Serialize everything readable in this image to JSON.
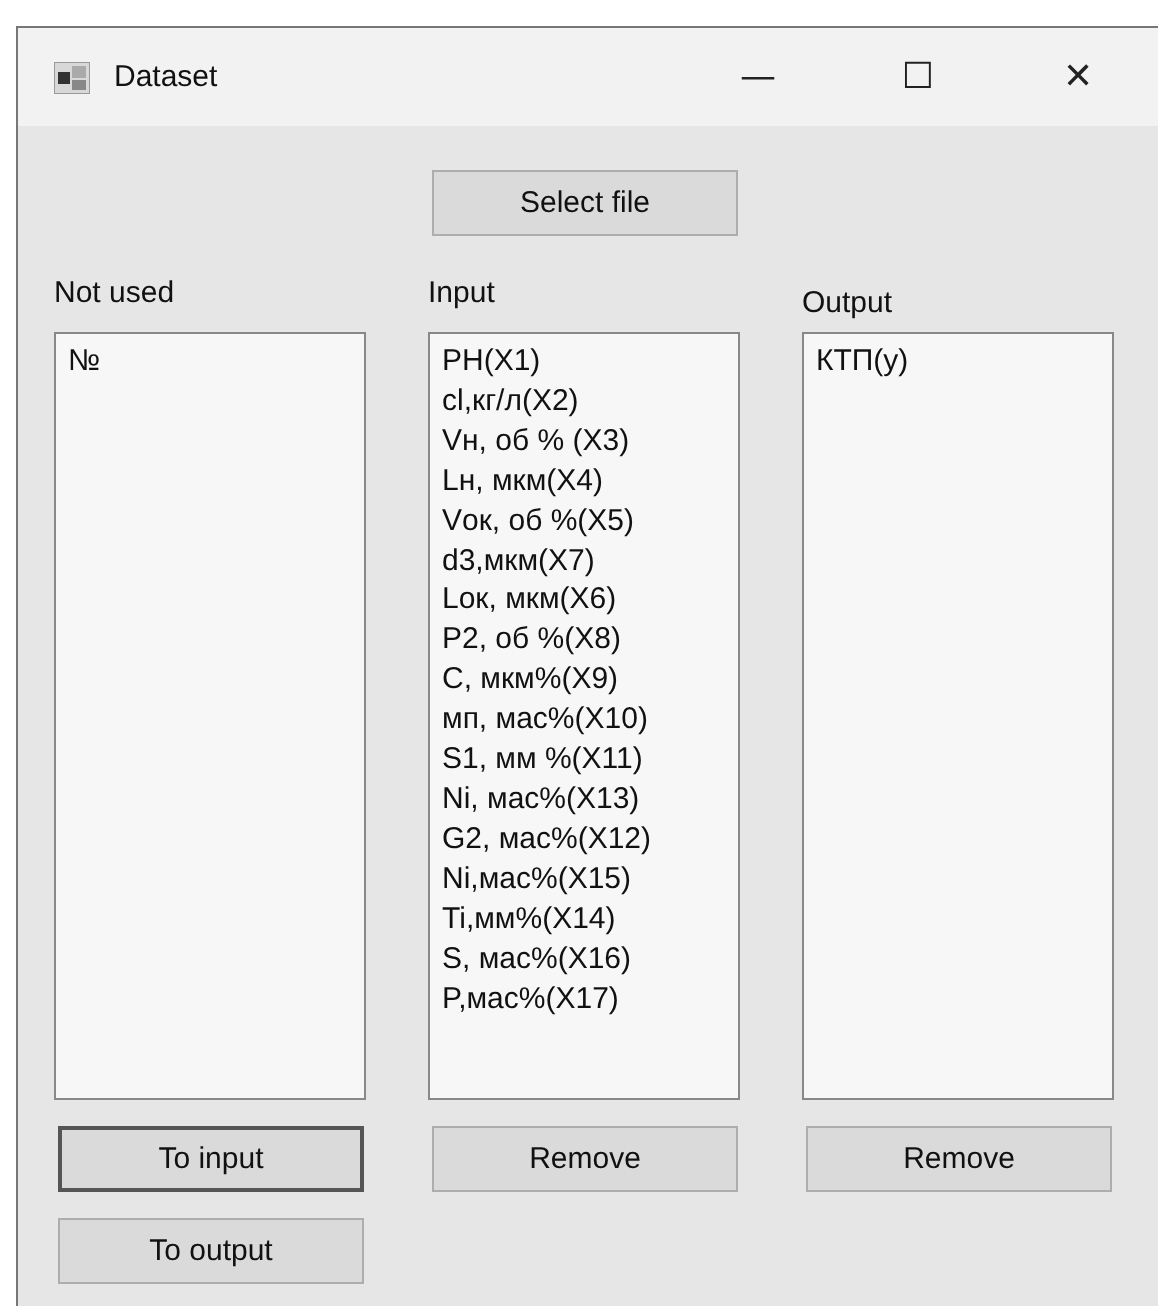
{
  "window": {
    "title": "Dataset",
    "controls": [
      "—",
      "☐",
      "✕"
    ]
  },
  "select_button": {
    "label": "Select file",
    "focused": false
  },
  "columns": [
    {
      "label": "Not used",
      "items": [
        "№"
      ],
      "buttons": [
        {
          "label": "To input",
          "focused": true
        },
        {
          "label": "To output",
          "focused": false
        }
      ]
    },
    {
      "label": "Input",
      "items": [
        "PH(X1)",
        "cl,кг/л(X2)",
        "Vн, об % (X3)",
        "Lн, мкм(X4)",
        "Vок, об %(X5)",
        "d3,мкм(X7)",
        "Lок, мкм(X6)",
        "P2, об %(X8)",
        "C, мкм%(X9)",
        "мп, мас%(X10)",
        "S1, мм %(X11)",
        "Ni, мас%(X13)",
        "G2, мас%(X12)",
        "Ni,мас%(X15)",
        "Ti,мм%(X14)",
        "S, мас%(X16)",
        "P,мас%(X17)"
      ],
      "buttons": [
        {
          "label": "Remove",
          "focused": false
        }
      ]
    },
    {
      "label": "Output",
      "items": [
        "КТП(у)"
      ],
      "buttons": [
        {
          "label": "Remove",
          "focused": false
        }
      ]
    }
  ]
}
